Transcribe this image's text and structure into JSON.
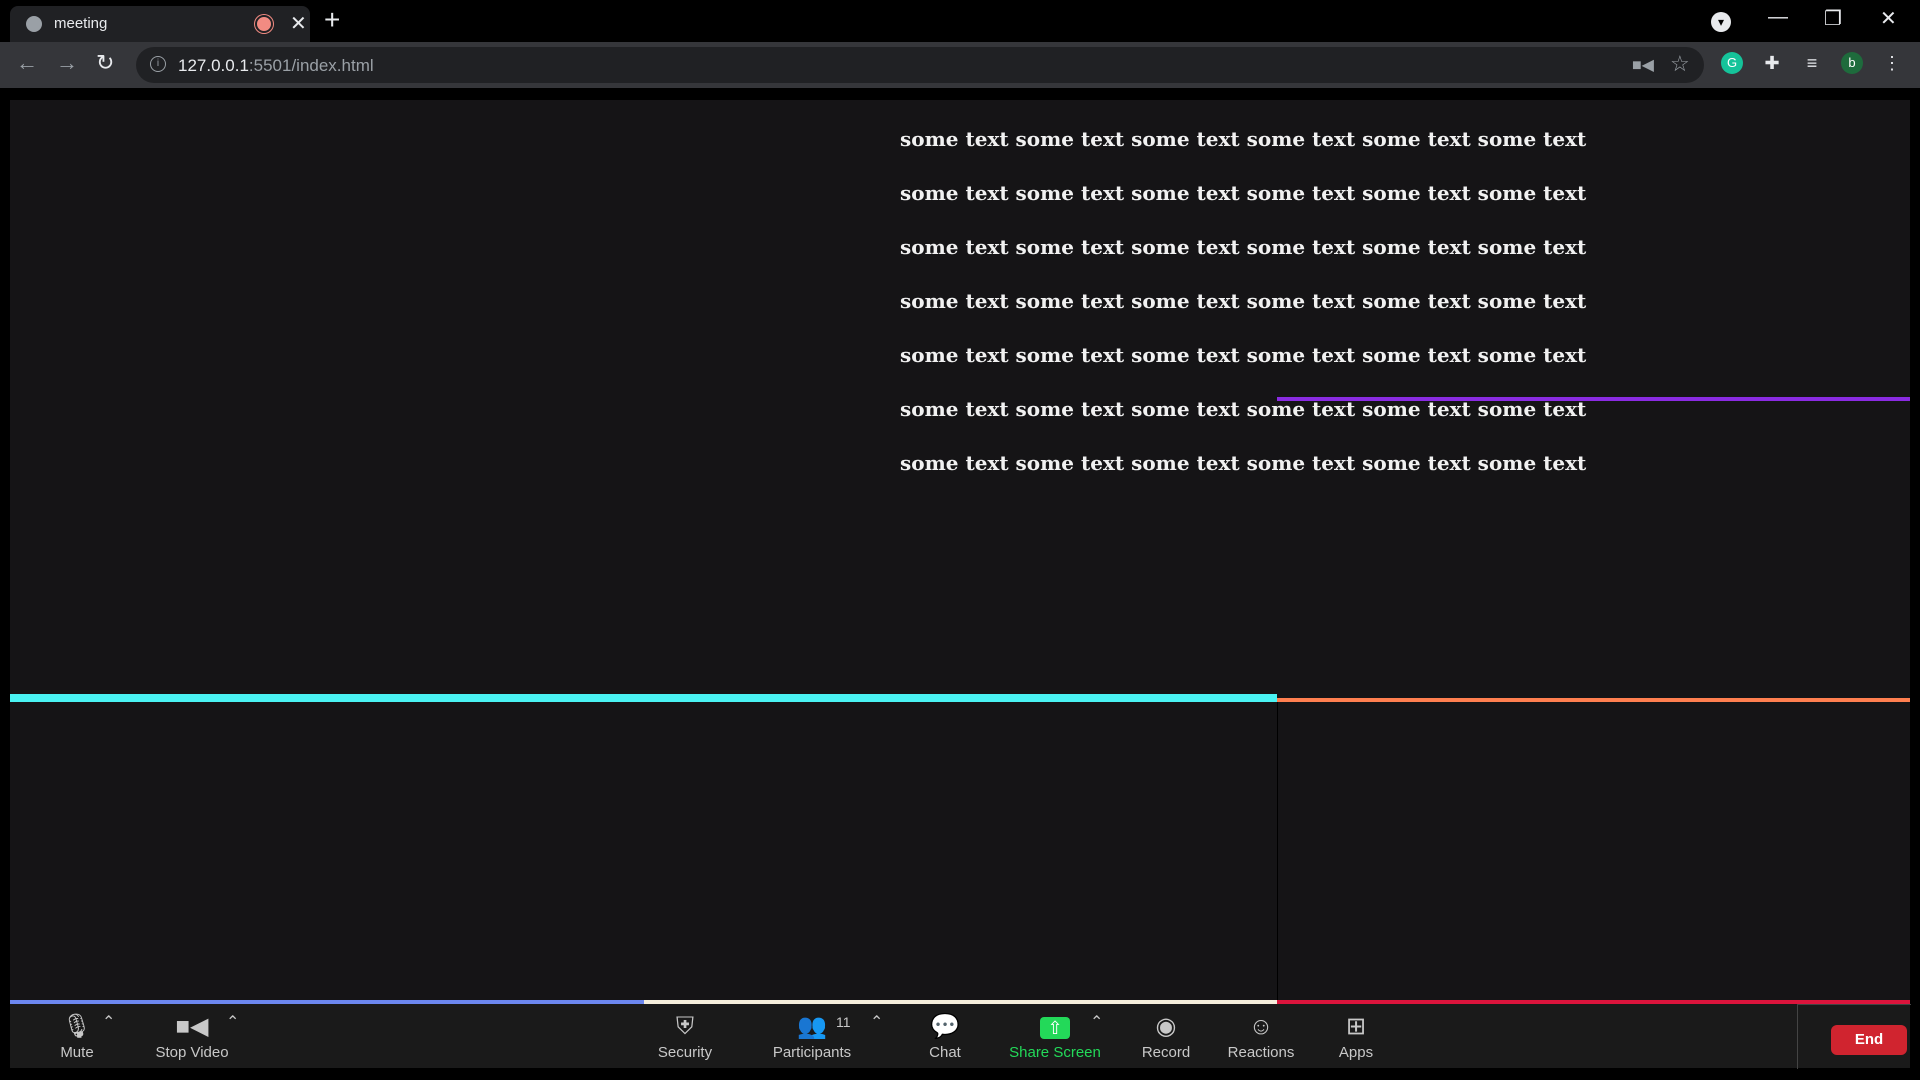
{
  "browser": {
    "tab_title": "meeting",
    "tab_close": "✕",
    "new_tab": "+",
    "url_host": "127.0.0.1",
    "url_path": ":5501/index.html",
    "profile_initial": "b",
    "grammarly_initial": "G",
    "window_controls": {
      "minimize": "—",
      "restore": "❐",
      "close": "✕"
    }
  },
  "content": {
    "lines": [
      "some text some text some text some text some text some text",
      "some text some text some text some text some text some text",
      "some text some text some text some text some text some text",
      "some text some text some text some text some text some text",
      "some text some text some text some text some text some text",
      "some text some text some text some text some text some text",
      "some text some text some text some text some text some text"
    ]
  },
  "divider_colors": {
    "purple": "#8a2be2",
    "cyan": "#4af3f3",
    "orange": "#ff7f50",
    "blue": "#6c87f0",
    "cream": "#f5eedc",
    "red": "#dc143c"
  },
  "zoom_toolbar": {
    "mute": "Mute",
    "stop_video": "Stop Video",
    "security": "Security",
    "participants": "Participants",
    "participants_count": "11",
    "chat": "Chat",
    "share_screen": "Share Screen",
    "record": "Record",
    "reactions": "Reactions",
    "apps": "Apps",
    "end": "End"
  }
}
